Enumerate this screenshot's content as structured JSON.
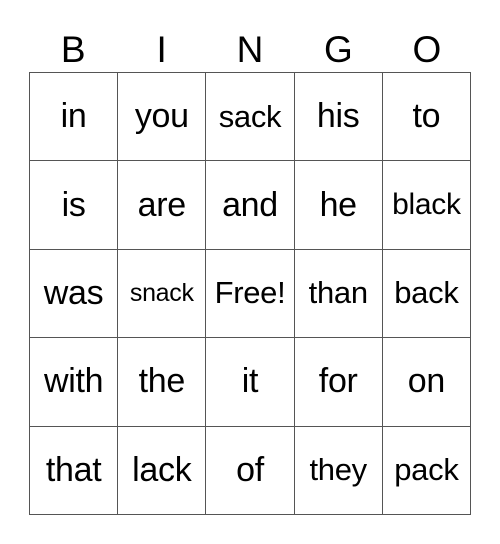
{
  "header": [
    "B",
    "I",
    "N",
    "G",
    "O"
  ],
  "rows": [
    [
      "in",
      "you",
      "sack",
      "his",
      "to"
    ],
    [
      "is",
      "are",
      "and",
      "he",
      "black"
    ],
    [
      "was",
      "snack",
      "Free!",
      "than",
      "back"
    ],
    [
      "with",
      "the",
      "it",
      "for",
      "on"
    ],
    [
      "that",
      "lack",
      "of",
      "they",
      "pack"
    ]
  ]
}
